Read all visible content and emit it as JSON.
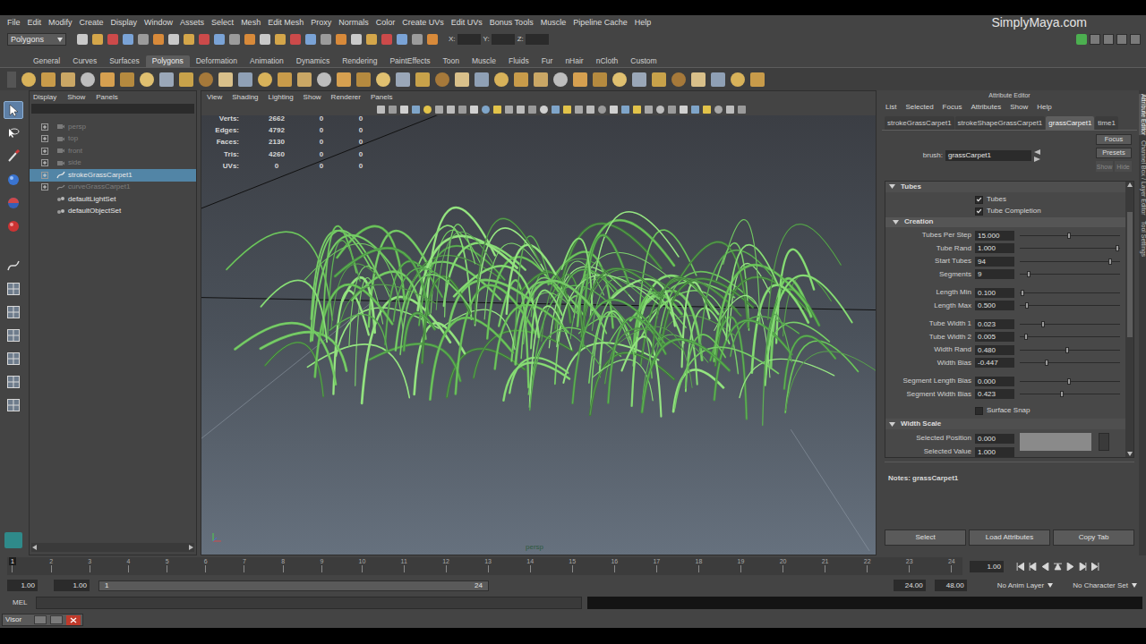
{
  "menu_bar": {
    "items": [
      "File",
      "Edit",
      "Modify",
      "Create",
      "Display",
      "Window",
      "Assets",
      "Select",
      "Mesh",
      "Edit Mesh",
      "Proxy",
      "Normals",
      "Color",
      "Create UVs",
      "Edit UVs",
      "Bonus Tools",
      "Muscle",
      "Pipeline Cache",
      "Help"
    ],
    "watermark": "SimplyMaya.com"
  },
  "status_line": {
    "mode": "Polygons",
    "fields": [
      {
        "label": "X:",
        "value": ""
      },
      {
        "label": "Y:",
        "value": ""
      },
      {
        "label": "Z:",
        "value": ""
      }
    ]
  },
  "shelf": {
    "tabs": [
      {
        "label": "General",
        "selected": false
      },
      {
        "label": "Curves",
        "selected": false
      },
      {
        "label": "Surfaces",
        "selected": false
      },
      {
        "label": "Polygons",
        "selected": true
      },
      {
        "label": "Deformation",
        "selected": false
      },
      {
        "label": "Animation",
        "selected": false
      },
      {
        "label": "Dynamics",
        "selected": false
      },
      {
        "label": "Rendering",
        "selected": false
      },
      {
        "label": "PaintEffects",
        "selected": false
      },
      {
        "label": "Toon",
        "selected": false
      },
      {
        "label": "Muscle",
        "selected": false
      },
      {
        "label": "Fluids",
        "selected": false
      },
      {
        "label": "Fur",
        "selected": false
      },
      {
        "label": "nHair",
        "selected": false
      },
      {
        "label": "nCloth",
        "selected": false
      },
      {
        "label": "Custom",
        "selected": false
      }
    ]
  },
  "toolbox": {
    "tools": [
      {
        "kind": "select",
        "selected": true
      },
      {
        "kind": "lasso",
        "selected": false
      },
      {
        "kind": "paint",
        "selected": false
      },
      {
        "kind": "move",
        "selected": false
      },
      {
        "kind": "rotate",
        "selected": false
      },
      {
        "kind": "scale",
        "selected": false
      },
      {
        "kind": "last",
        "selected": false
      },
      {
        "kind": "layout",
        "selected": false
      },
      {
        "kind": "layout",
        "selected": false
      },
      {
        "kind": "layout",
        "selected": false
      },
      {
        "kind": "layout",
        "selected": false
      },
      {
        "kind": "layout",
        "selected": false
      },
      {
        "kind": "layout",
        "selected": false
      }
    ]
  },
  "outliner": {
    "menu": [
      "Display",
      "Show",
      "Panels"
    ],
    "items": [
      {
        "label": "persp",
        "kind": "camera",
        "expandable": true,
        "dimmed": true,
        "selected": false
      },
      {
        "label": "top",
        "kind": "camera",
        "expandable": true,
        "dimmed": true,
        "selected": false
      },
      {
        "label": "front",
        "kind": "camera",
        "expandable": true,
        "dimmed": true,
        "selected": false
      },
      {
        "label": "side",
        "kind": "camera",
        "expandable": true,
        "dimmed": true,
        "selected": false
      },
      {
        "label": "strokeGrassCarpet1",
        "kind": "stroke",
        "expandable": true,
        "dimmed": false,
        "selected": true
      },
      {
        "label": "curveGrassCarpet1",
        "kind": "curve",
        "expandable": true,
        "dimmed": true,
        "selected": false
      },
      {
        "label": "defaultLightSet",
        "kind": "set",
        "expandable": false,
        "dimmed": false,
        "selected": false
      },
      {
        "label": "defaultObjectSet",
        "kind": "set",
        "expandable": false,
        "dimmed": false,
        "selected": false
      }
    ]
  },
  "viewport": {
    "menu": [
      "View",
      "Shading",
      "Lighting",
      "Show",
      "Renderer",
      "Panels"
    ],
    "hud": [
      {
        "label": "Verts:",
        "values": [
          "2662",
          "0",
          "0"
        ]
      },
      {
        "label": "Edges:",
        "values": [
          "4792",
          "0",
          "0"
        ]
      },
      {
        "label": "Faces:",
        "values": [
          "2130",
          "0",
          "0"
        ]
      },
      {
        "label": "Tris:",
        "values": [
          "4260",
          "0",
          "0"
        ]
      },
      {
        "label": "UVs:",
        "values": [
          "0",
          "0",
          "0"
        ]
      }
    ],
    "camera_label": "persp"
  },
  "attribute_editor": {
    "title": "Attribute Editor",
    "menu": [
      "List",
      "Selected",
      "Focus",
      "Attributes",
      "Show",
      "Help"
    ],
    "tabs": [
      {
        "label": "strokeGrassCarpet1",
        "selected": false
      },
      {
        "label": "strokeShapeGrassCarpet1",
        "selected": false
      },
      {
        "label": "grassCarpet1",
        "selected": true
      },
      {
        "label": "time1",
        "selected": false
      }
    ],
    "node_label": "brush:",
    "node_name": "grassCarpet1",
    "buttons": [
      {
        "label": "Focus",
        "disabled": false
      },
      {
        "label": "Presets",
        "disabled": false
      },
      {
        "label": "Show",
        "disabled": true
      },
      {
        "label": "Hide",
        "disabled": true
      }
    ],
    "tubes": {
      "title": "Tubes",
      "expanded": true,
      "checkboxes": [
        {
          "label": "Tubes",
          "checked": true
        },
        {
          "label": "Tube Completion",
          "checked": true
        }
      ]
    },
    "creation": {
      "title": "Creation",
      "expanded": true,
      "groups": [
        [
          {
            "label": "Tubes Per Step",
            "value": "15.000",
            "level": 0.49
          },
          {
            "label": "Tube Rand",
            "value": "1.000",
            "level": 0.97
          },
          {
            "label": "Start Tubes",
            "value": "94",
            "level": 0.9
          },
          {
            "label": "Segments",
            "value": "9",
            "level": 0.09
          }
        ],
        [
          {
            "label": "Length Min",
            "value": "0.100",
            "level": 0.03
          },
          {
            "label": "Length Max",
            "value": "0.500",
            "level": 0.07
          }
        ],
        [
          {
            "label": "Tube Width 1",
            "value": "0.023",
            "level": 0.23
          },
          {
            "label": "Tube Width 2",
            "value": "0.005",
            "level": 0.06
          },
          {
            "label": "Width Rand",
            "value": "0.480",
            "level": 0.47
          },
          {
            "label": "Width Bias",
            "value": "-0.447",
            "level": 0.27
          }
        ],
        [
          {
            "label": "Segment Length Bias",
            "value": "0.000",
            "level": 0.49
          },
          {
            "label": "Segment Width Bias",
            "value": "0.423",
            "level": 0.42
          }
        ]
      ],
      "surface_snap": {
        "label": "Surface Snap",
        "checked": false
      }
    },
    "width_scale": {
      "title": "Width Scale",
      "expanded": true,
      "fields": [
        {
          "label": "Selected Position",
          "value": "0.000"
        },
        {
          "label": "Selected Value",
          "value": "1.000"
        }
      ]
    },
    "notes": "Notes: grassCarpet1",
    "footer_buttons": [
      "Select",
      "Load Attributes",
      "Copy Tab"
    ]
  },
  "side_tabs": [
    {
      "label": "Attribute Editor",
      "selected": true
    },
    {
      "label": "Channel Box / Layer Editor",
      "selected": false
    },
    {
      "label": "Tool Settings",
      "selected": false
    }
  ],
  "timeline": {
    "ticks": [
      "1",
      "2",
      "3",
      "4",
      "5",
      "6",
      "7",
      "8",
      "9",
      "10",
      "11",
      "12",
      "13",
      "14",
      "15",
      "16",
      "17",
      "18",
      "19",
      "20",
      "21",
      "22",
      "23",
      "24"
    ],
    "current_tick": "1",
    "current_frame": "1.00"
  },
  "range": {
    "start": "1.00",
    "playback_start": "1.00",
    "slider_start": "1",
    "slider_end": "24",
    "playback_end": "24.00",
    "end": "48.00",
    "anim_layer": "No Anim Layer",
    "character_set": "No Character Set"
  },
  "command_line": {
    "language": "MEL"
  },
  "taskbar": {
    "windows": [
      {
        "label": "Visor"
      }
    ]
  }
}
